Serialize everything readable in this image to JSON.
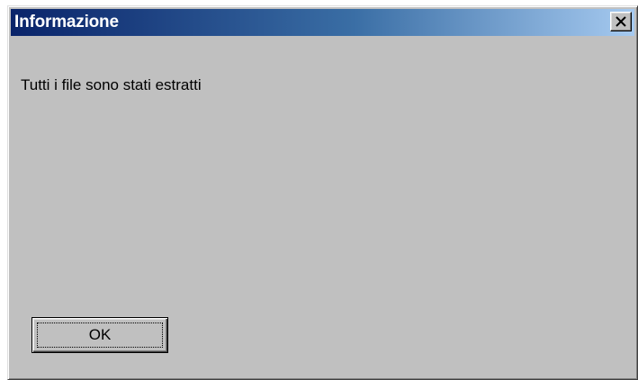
{
  "window": {
    "title": "Informazione",
    "close_icon": "close-icon"
  },
  "body": {
    "message": "Tutti i file sono stati estratti"
  },
  "buttons": {
    "ok_label": "OK"
  },
  "colors": {
    "titlebar_start": "#0a246a",
    "titlebar_end": "#a6caf0",
    "dialog_face": "#c0c0c0"
  }
}
